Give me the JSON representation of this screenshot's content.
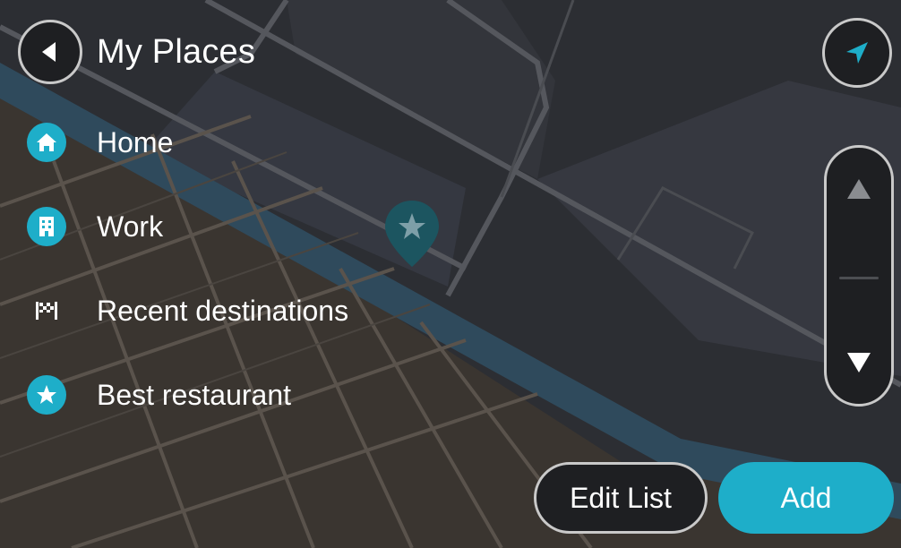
{
  "header": {
    "title": "My Places",
    "back_icon": "back-arrow-icon"
  },
  "places": [
    {
      "label": "Home",
      "icon": "home-icon"
    },
    {
      "label": "Work",
      "icon": "work-building-icon"
    },
    {
      "label": "Recent destinations",
      "icon": "checkered-flag-icon"
    },
    {
      "label": "Best restaurant",
      "icon": "star-icon"
    }
  ],
  "actions": {
    "edit_label": "Edit List",
    "add_label": "Add"
  },
  "colors": {
    "accent": "#1eaec9",
    "background": "#2b2d31",
    "button_dark": "#1e1f22",
    "button_border": "#c9c9c9"
  }
}
